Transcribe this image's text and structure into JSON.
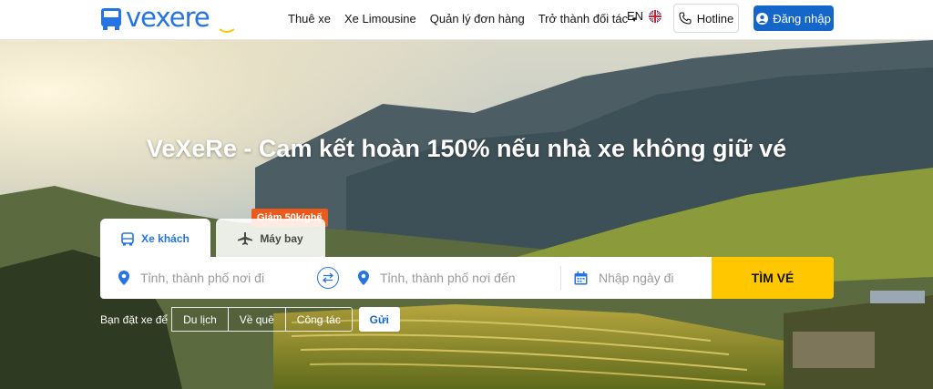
{
  "header": {
    "logo_text": "vexere",
    "nav": [
      {
        "label": "Thuê xe"
      },
      {
        "label": "Xe Limousine"
      },
      {
        "label": "Quản lý đơn hàng"
      },
      {
        "label": "Trở thành đối tác"
      }
    ],
    "language": "EN",
    "hotline_label": "Hotline",
    "login_label": "Đăng nhập"
  },
  "hero": {
    "headline": "VeXeRe - Cam kết hoàn 150% nếu nhà xe không giữ vé"
  },
  "tabs": [
    {
      "label": "Xe khách",
      "icon": "bus-icon",
      "active": true
    },
    {
      "label": "Máy bay",
      "icon": "airplane-icon",
      "active": false
    }
  ],
  "promo_badge": "Giảm 50k/ghế",
  "search": {
    "from_placeholder": "Tỉnh, thành phố nơi đi",
    "to_placeholder": "Tỉnh, thành phố nơi đến",
    "date_placeholder": "Nhập ngày đi",
    "button_label": "TÌM VÉ"
  },
  "purpose": {
    "label": "Bạn đặt xe để",
    "options": [
      "Du lịch",
      "Về quê",
      "Công tác"
    ],
    "send_label": "Gửi"
  },
  "colors": {
    "brand": "#2474e5",
    "login_bg": "#1466c9",
    "search_button": "#ffc700",
    "promo": "#eb5a1a"
  }
}
